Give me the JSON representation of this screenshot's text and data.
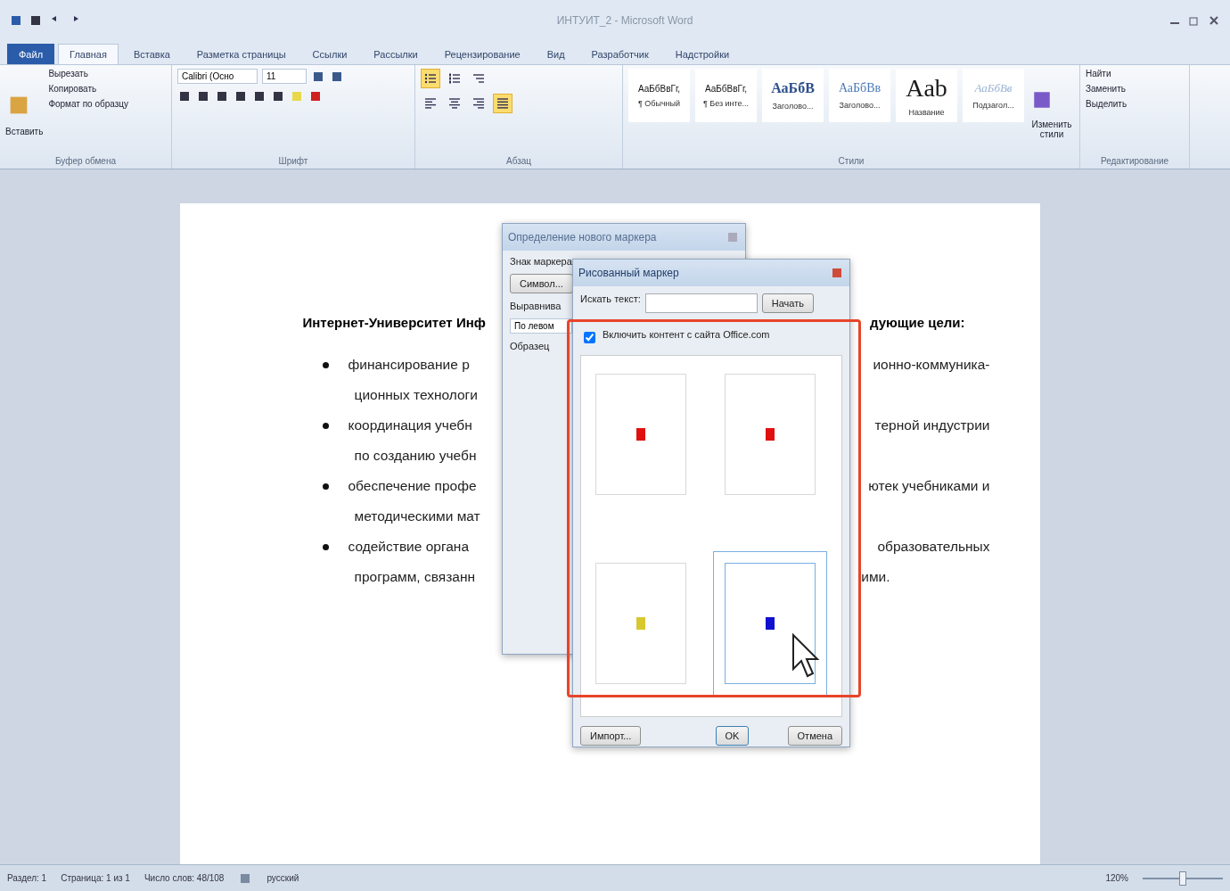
{
  "window": {
    "title": "ИНТУИТ_2 - Microsoft Word"
  },
  "tabs": [
    {
      "label": "Файл",
      "kind": "file",
      "selected": false
    },
    {
      "label": "Главная",
      "kind": "tab",
      "selected": true
    },
    {
      "label": "Вставка",
      "kind": "tab",
      "selected": false
    },
    {
      "label": "Разметка страницы",
      "kind": "tab",
      "selected": false
    },
    {
      "label": "Ссылки",
      "kind": "tab",
      "selected": false
    },
    {
      "label": "Рассылки",
      "kind": "tab",
      "selected": false
    },
    {
      "label": "Рецензирование",
      "kind": "tab",
      "selected": false
    },
    {
      "label": "Вид",
      "kind": "tab",
      "selected": false
    },
    {
      "label": "Разработчик",
      "kind": "tab",
      "selected": false
    },
    {
      "label": "Надстройки",
      "kind": "tab",
      "selected": false
    }
  ],
  "ribbon": {
    "clipboard": {
      "paste": "Вставить",
      "items": [
        "Вырезать",
        "Копировать",
        "Формат по образцу"
      ],
      "label": "Буфер обмена"
    },
    "font": {
      "font_name": "Calibri (Осно",
      "font_size": "11",
      "label": "Шрифт"
    },
    "paragraph": {
      "label": "Абзац",
      "buttons": [
        {
          "kind": "bullets",
          "active": true
        },
        {
          "kind": "numbering",
          "active": false
        },
        {
          "kind": "multilevel",
          "active": false
        },
        {
          "kind": "left",
          "active": false
        },
        {
          "kind": "center",
          "active": false
        },
        {
          "kind": "right",
          "active": false
        },
        {
          "kind": "justify",
          "active": true
        }
      ]
    },
    "styles": {
      "items": [
        {
          "preview": "АаБбВвГг,",
          "name": "¶ Обычный",
          "kind": "normal"
        },
        {
          "preview": "АаБбВвГг,",
          "name": "¶ Без инте...",
          "kind": "normal"
        },
        {
          "preview": "АаБбВ",
          "name": "Заголово...",
          "kind": "heading"
        },
        {
          "preview": "АаБбВв",
          "name": "Заголово...",
          "kind": "heading2"
        },
        {
          "preview": "Aab",
          "name": "Название",
          "kind": "title"
        },
        {
          "preview": "АаБбВв",
          "name": "Подзагол...",
          "kind": "subtitle"
        }
      ],
      "change_styles": "Изменить стили",
      "label": "Стили"
    },
    "editing": {
      "items": [
        "Найти",
        "Заменить",
        "Выделить"
      ],
      "label": "Редактирование"
    }
  },
  "document": {
    "heading_left": "Интернет-Университет Инф",
    "heading_right": "дующие цели:",
    "lines": [
      {
        "bullet": true,
        "left": "финансирование р",
        "right": "ионно-коммуника-"
      },
      {
        "bullet": false,
        "left": "ционных технологи"
      },
      {
        "bullet": true,
        "left": "координация учебн",
        "right": "терной индустрии"
      },
      {
        "bullet": false,
        "left": "по созданию учебн"
      },
      {
        "bullet": true,
        "left": "обеспечение профе",
        "right": "ютек учебниками и"
      },
      {
        "bullet": false,
        "left": "методическими мат"
      },
      {
        "bullet": true,
        "left": "содействие органа",
        "right": "образовательных"
      },
      {
        "bullet": false,
        "left": "программ, связанн",
        "right": "ими."
      }
    ]
  },
  "dialog_bullet": {
    "title": "Определение нового маркера",
    "marker_label": "Знак маркера",
    "symbol_button": "Символ...",
    "align_label": "Выравнива",
    "align_value": "По левом",
    "sample_label": "Образец"
  },
  "dialog_picture": {
    "title": "Рисованный маркер",
    "search_label": "Искать текст:",
    "search_button": "Начать",
    "include_office": {
      "label": "Включить контент с сайта Office.com",
      "checked": true
    },
    "bullets": [
      {
        "color": "#e01010",
        "selected": false
      },
      {
        "color": "#e01010",
        "selected": false
      },
      {
        "color": "#d8c830",
        "selected": false
      },
      {
        "color": "#1010d0",
        "selected": true
      }
    ],
    "buttons": [
      {
        "label": "Импорт...",
        "kind": "import"
      },
      {
        "label": "OK",
        "kind": "ok"
      },
      {
        "label": "Отмена",
        "kind": "cancel"
      }
    ]
  },
  "status_bar": {
    "section": "Раздел: 1",
    "page": "Страница: 1 из 1",
    "words": "Число слов: 48/108",
    "language": "русский",
    "zoom": "120%",
    "zoom_slider": {
      "level": 0.5
    }
  }
}
